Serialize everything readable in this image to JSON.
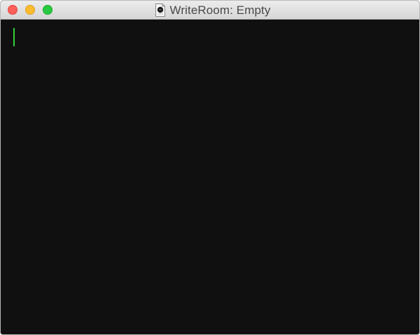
{
  "window": {
    "title": "WriteRoom: Empty",
    "document_icon": "writeroom-document-icon"
  },
  "titlebar_buttons": [
    {
      "name": "close",
      "color": "#fc5f57"
    },
    {
      "name": "minimize",
      "color": "#fdbc2e"
    },
    {
      "name": "zoom",
      "color": "#29c941"
    }
  ],
  "editor": {
    "text": "",
    "background_color": "#101010",
    "caret_color": "#35d03a"
  }
}
